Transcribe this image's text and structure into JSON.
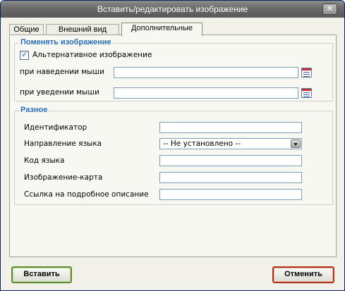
{
  "window": {
    "title": "Вставить/редактировать изображение",
    "close_glyph": "✕"
  },
  "tabs": [
    {
      "label": "Общие",
      "active": false
    },
    {
      "label": "Внешний вид",
      "active": false
    },
    {
      "label": "Дополнительные",
      "active": true
    }
  ],
  "swap_image": {
    "legend": "Поменять изображение",
    "alternative_checkbox": {
      "label": "Альтернативное изображение",
      "checked": true,
      "glyph": "✓"
    },
    "on_mouse_over": {
      "label": "при наведении мыши",
      "value": "",
      "icon": "browse-icon"
    },
    "on_mouse_out": {
      "label": "при уведении мыши",
      "value": "",
      "icon": "browse-icon"
    }
  },
  "misc": {
    "legend": "Разное",
    "id": {
      "label": "Идентификатор",
      "value": ""
    },
    "direction": {
      "label": "Направление языка",
      "selected": "-- Не установлено --"
    },
    "lang_code": {
      "label": "Код языка",
      "value": ""
    },
    "image_map": {
      "label": "Изображение-карта",
      "value": ""
    },
    "long_desc": {
      "label": "Ссылка на подробное описание",
      "value": ""
    }
  },
  "buttons": {
    "insert": "Вставить",
    "cancel": "Отменить"
  },
  "colors": {
    "legend": "#2b6fb6",
    "insert_border": "#5d8a2a",
    "cancel_border": "#b0341c"
  }
}
